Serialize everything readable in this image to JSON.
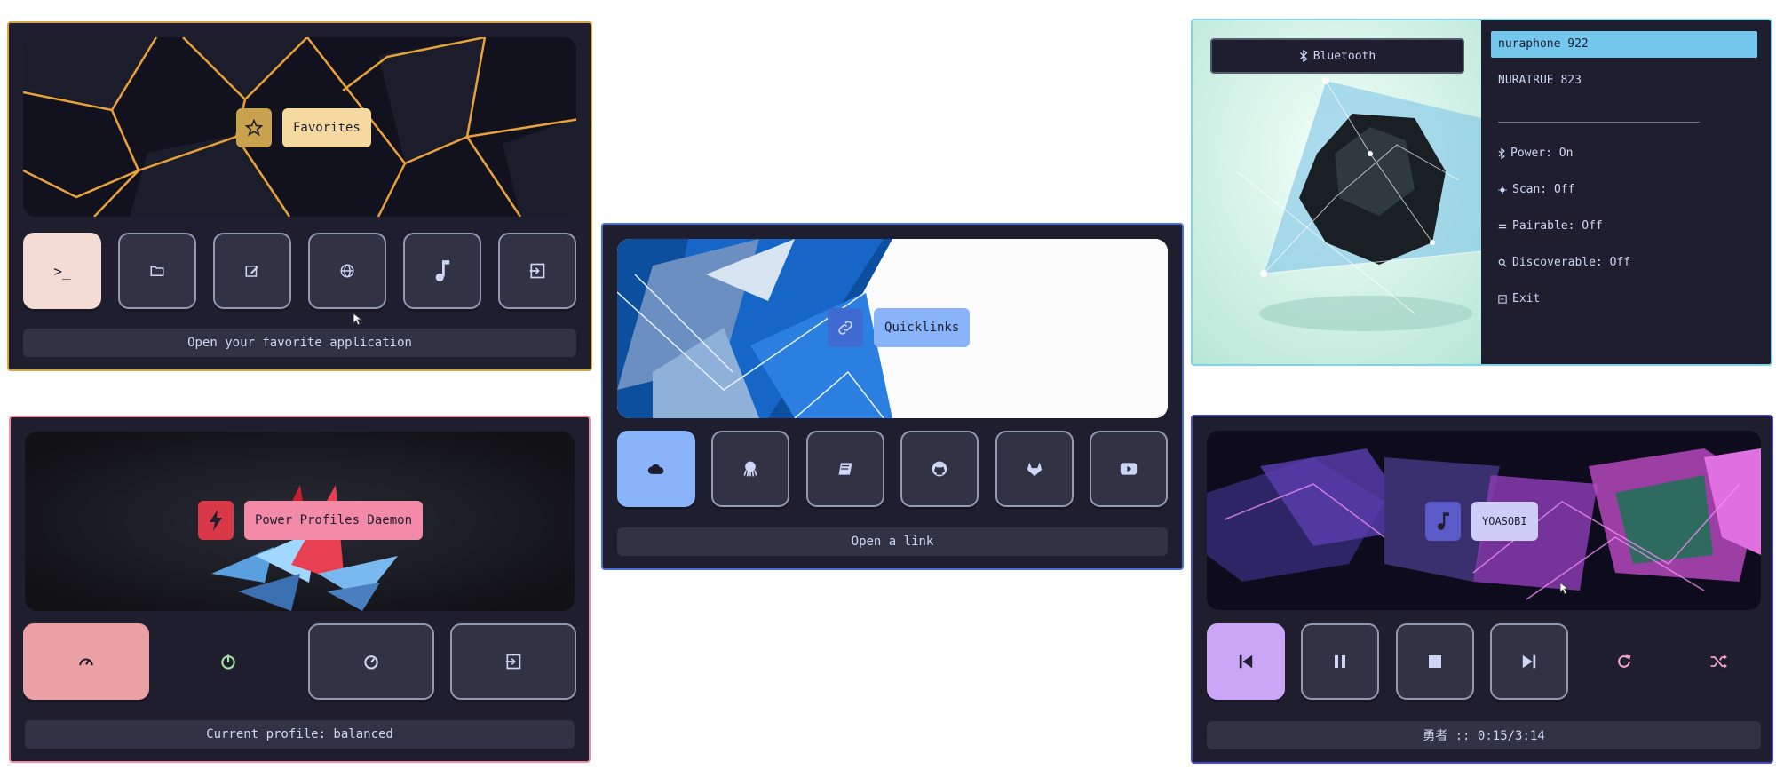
{
  "favorites": {
    "label": "Favorites",
    "footer": "Open your favorite application",
    "buttons": [
      "terminal-icon",
      "folder-icon",
      "edit-icon",
      "globe-icon",
      "music-icon",
      "exit-icon"
    ]
  },
  "power": {
    "label": "Power Profiles Daemon",
    "footer": "Current profile: balanced",
    "buttons": [
      "performance-icon",
      "power-saver-icon",
      "balanced-icon",
      "exit-icon"
    ]
  },
  "quicklinks": {
    "label": "Quicklinks",
    "footer": "Open a link",
    "buttons": [
      "cloud-icon",
      "octopus-icon",
      "book-icon",
      "github-icon",
      "gitlab-icon",
      "youtube-icon"
    ]
  },
  "bluetooth": {
    "label": "Bluetooth",
    "devices": [
      "nuraphone 922",
      "NURATRUE 823"
    ],
    "separator": "_____________________________",
    "options": [
      "Power: On",
      "Scan: Off",
      "Pairable: Off",
      "Discoverable: Off",
      "Exit"
    ]
  },
  "music": {
    "label": "YOASOBI",
    "footer": "勇者 :: 0:15/3:14",
    "buttons": [
      "previous-icon",
      "pause-icon",
      "stop-icon",
      "next-icon",
      "repeat-icon",
      "shuffle-icon"
    ]
  },
  "colors": {
    "favorites_border": "#d4a64a",
    "power_border": "#f38ba8",
    "quicklinks_border": "#4a6fd8",
    "bluetooth_border": "#7fd3e8",
    "music_border": "#4a4ac0",
    "panel_bg": "#1e1e2e"
  }
}
